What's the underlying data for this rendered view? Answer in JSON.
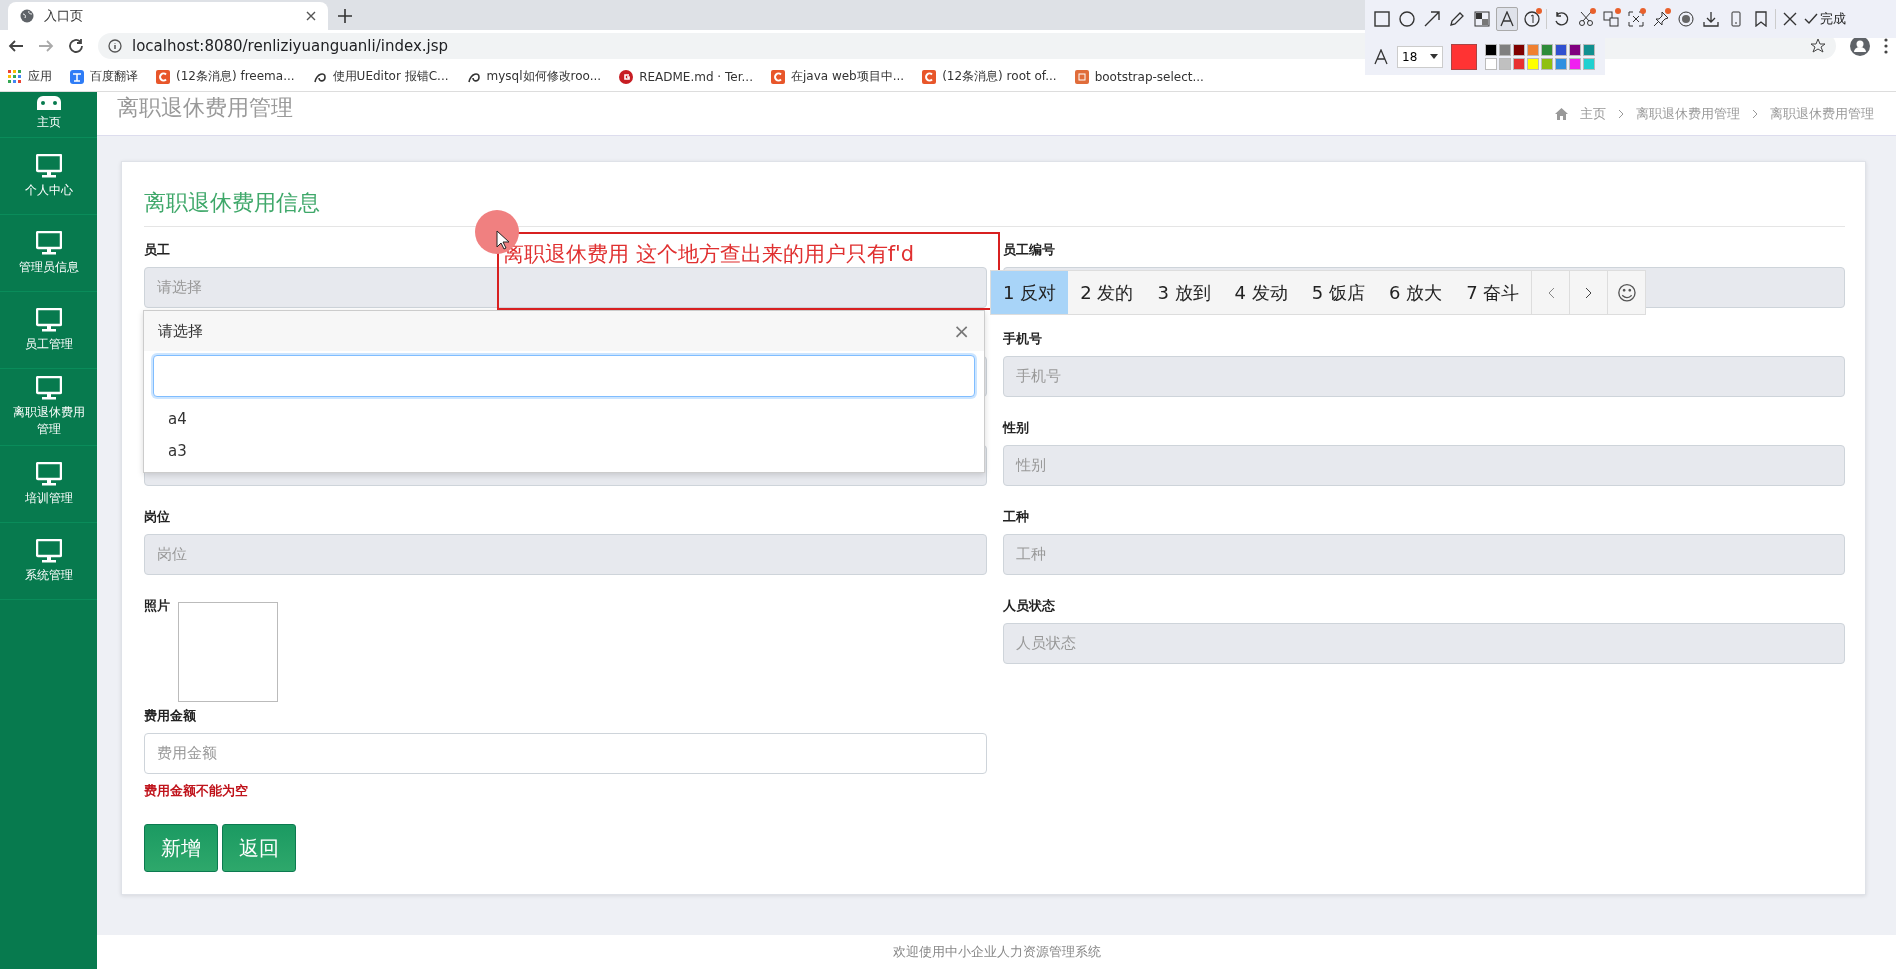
{
  "browser": {
    "tab": {
      "title": "入口页"
    },
    "url": "localhost:8080/renliziyuanguanli/index.jsp",
    "bookmarks": [
      {
        "kind": "apps",
        "label": "应用"
      },
      {
        "kind": "translate",
        "label": "百度翻译"
      },
      {
        "kind": "csdn",
        "label": "(12条消息) freema..."
      },
      {
        "kind": "swirl",
        "label": "使用UEditor 报错C..."
      },
      {
        "kind": "swirl",
        "label": "mysql如何修改roo..."
      },
      {
        "kind": "gitee",
        "label": "README.md · Ter..."
      },
      {
        "kind": "csdn",
        "label": "在java web项目中..."
      },
      {
        "kind": "csdn",
        "label": "(12条消息) root of..."
      },
      {
        "kind": "jian",
        "label": "bootstrap-select..."
      }
    ]
  },
  "capture_toolbar": {
    "tools": [
      {
        "kind": "rect",
        "selected": false,
        "badge": false
      },
      {
        "kind": "circle",
        "selected": false,
        "badge": false
      },
      {
        "kind": "arrow",
        "selected": false,
        "badge": false
      },
      {
        "kind": "pencil",
        "selected": false,
        "badge": false
      },
      {
        "kind": "mosaic",
        "selected": false,
        "badge": false
      },
      {
        "kind": "text",
        "selected": true,
        "badge": false
      },
      {
        "kind": "number",
        "selected": false,
        "badge": true
      },
      {
        "kind": "divider"
      },
      {
        "kind": "undo",
        "selected": false,
        "badge": false
      },
      {
        "kind": "cut",
        "selected": false,
        "badge": true
      },
      {
        "kind": "translate",
        "selected": false,
        "badge": true
      },
      {
        "kind": "ocr",
        "selected": false,
        "badge": true
      },
      {
        "kind": "pin",
        "selected": false,
        "badge": true
      },
      {
        "kind": "record",
        "selected": false,
        "badge": false
      },
      {
        "kind": "download",
        "selected": false,
        "badge": false
      },
      {
        "kind": "phone",
        "selected": false,
        "badge": false
      },
      {
        "kind": "bookmark",
        "selected": false,
        "badge": false
      },
      {
        "kind": "divider"
      },
      {
        "kind": "close",
        "selected": false,
        "badge": false
      }
    ],
    "done": "完成",
    "font_size": "18",
    "current": {
      "color": "#ff3333"
    },
    "palette": [
      {
        "color": "#000000"
      },
      {
        "color": "#808080"
      },
      {
        "color": "#800000"
      },
      {
        "color": "#f08030"
      },
      {
        "color": "#2e8b3a"
      },
      {
        "color": "#3050d0"
      },
      {
        "color": "#800080"
      },
      {
        "color": "#109090"
      },
      {
        "color": "#ffffff"
      },
      {
        "color": "#c0c0c0"
      },
      {
        "color": "#e83030"
      },
      {
        "color": "#ffff00"
      },
      {
        "color": "#90c010"
      },
      {
        "color": "#3090e0"
      },
      {
        "color": "#f020f0"
      },
      {
        "color": "#20d0d0"
      }
    ]
  },
  "sidebar": {
    "items": [
      {
        "kind": "home",
        "label": "主页"
      },
      {
        "kind": "monitor",
        "label": "个人中心"
      },
      {
        "kind": "monitor",
        "label": "管理员信息"
      },
      {
        "kind": "monitor",
        "label": "员工管理"
      },
      {
        "kind": "monitor",
        "label": "离职退休费用管理"
      },
      {
        "kind": "monitor",
        "label": "培训管理"
      },
      {
        "kind": "monitor",
        "label": "系统管理"
      }
    ]
  },
  "header": {
    "title": "离职退休费用管理",
    "breadcrumb": [
      "主页",
      "离职退休费用管理",
      "离职退休费用管理"
    ]
  },
  "form": {
    "title": "离职退休费用信息",
    "left": [
      {
        "kind": "select",
        "label": "员工",
        "placeholder": "请选择"
      },
      {
        "kind": "hidden"
      },
      {
        "kind": "hidden"
      },
      {
        "kind": "text",
        "label": "岗位",
        "placeholder": "岗位"
      },
      {
        "kind": "image",
        "label": "照片"
      }
    ],
    "right": [
      {
        "kind": "text",
        "label": "员工编号"
      },
      {
        "kind": "text",
        "label": "手机号",
        "placeholder": "手机号"
      },
      {
        "kind": "text",
        "label": "性别",
        "placeholder": "性别"
      },
      {
        "kind": "text",
        "label": "工种",
        "placeholder": "工种"
      },
      {
        "kind": "text",
        "label": "人员状态",
        "placeholder": "人员状态"
      }
    ],
    "amount": {
      "label": "费用金额",
      "placeholder": "费用金额",
      "error": "费用金额不能为空"
    },
    "buttons": [
      "新增",
      "返回"
    ]
  },
  "dropdown": {
    "title": "请选择",
    "close": "×",
    "options": [
      "a4",
      "a3"
    ]
  },
  "annotation": {
    "text": "离职退休费用 这个地方查出来的用户只有f'd"
  },
  "ime": {
    "candidates": [
      {
        "label": "1 反对",
        "selected": true
      },
      {
        "label": "2 发的",
        "selected": false
      },
      {
        "label": "3 放到",
        "selected": false
      },
      {
        "label": "4 发动",
        "selected": false
      },
      {
        "label": "5 饭店",
        "selected": false
      },
      {
        "label": "6 放大",
        "selected": false
      },
      {
        "label": "7 奋斗",
        "selected": false
      }
    ],
    "emoji": "☺"
  },
  "footer": "欢迎使用中小企业人力资源管理系统"
}
